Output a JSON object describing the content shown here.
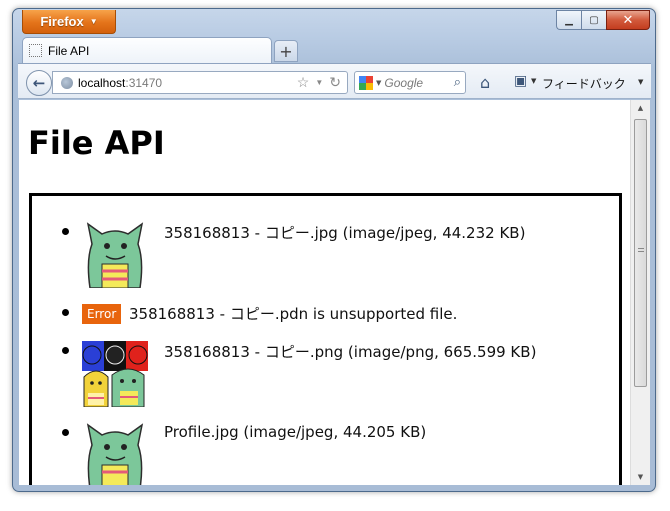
{
  "browser": {
    "menu_button_label": "Firefox",
    "window_controls": {
      "minimize": "▁",
      "maximize": "▢",
      "close": "✕"
    },
    "tab": {
      "title": "File API",
      "new_tab_label": "+"
    },
    "address": {
      "host": "localhost",
      "port": ":31470"
    },
    "search": {
      "engine": "Google"
    },
    "feedback_label": "フィードバック"
  },
  "page": {
    "title": "File API",
    "files": [
      {
        "caption": "358168813 - コピー.jpg (image/jpeg, 44.232 KB)",
        "thumb": "monster-single"
      },
      {
        "error_label": "Error",
        "caption": "358168813 - コピー.pdn is unsupported file."
      },
      {
        "caption": "358168813 - コピー.png (image/png, 665.599 KB)",
        "thumb": "monster-group"
      },
      {
        "caption": "Profile.jpg (image/jpeg, 44.205 KB)",
        "thumb": "monster-single"
      }
    ]
  },
  "colors": {
    "menu_button": "#e4731a",
    "error_badge": "#e8640c",
    "monster_green": "#7cc79a"
  }
}
